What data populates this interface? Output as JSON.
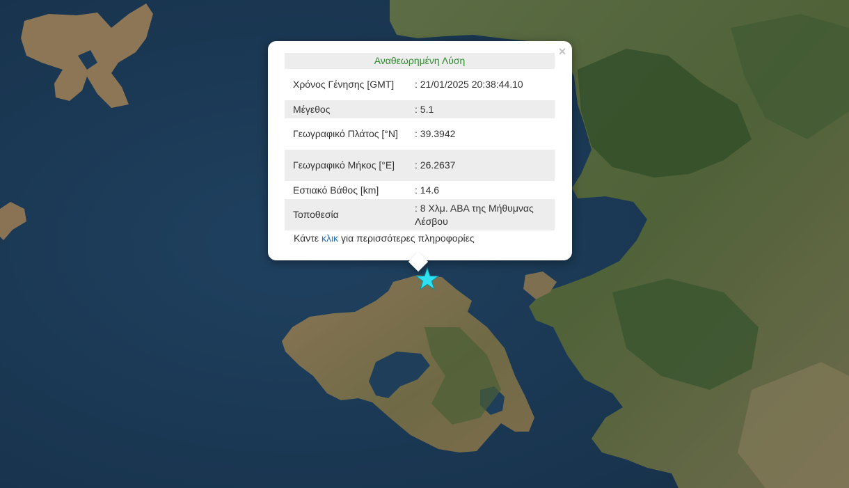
{
  "map": {
    "basemap": "satellite imagery",
    "colors": {
      "sea": "#1c3a55",
      "land": "#7a6a4f",
      "vegetation": "#3f5a32",
      "marker": "#2fe0f0"
    }
  },
  "popup": {
    "close_label": "×",
    "title": "Αναθεωρημένη Λύση",
    "rows": [
      {
        "label": "Χρόνος Γένησης [GMT]",
        "value": ": 21/01/2025 20:38:44.10"
      },
      {
        "label": "Μέγεθος",
        "value": ": 5.1"
      },
      {
        "label": "Γεωγραφικό Πλάτος [°N]",
        "value": ": 39.3942"
      },
      {
        "label": "Γεωγραφικό Μήκος [°E]",
        "value": ": 26.2637"
      },
      {
        "label": "Εστιακό Βάθος [km]",
        "value": ": 14.6"
      },
      {
        "label": "Τοποθεσία",
        "value": ": 8 Χλμ. ΑΒΑ της Μήθυμνας Λέσβου"
      }
    ],
    "more_prefix": "Κάντε",
    "more_link": "κλικ",
    "more_suffix": "για περισσότερες πληροφορίες"
  },
  "marker": {
    "icon": "star-icon",
    "color": "#2fe0f0"
  }
}
